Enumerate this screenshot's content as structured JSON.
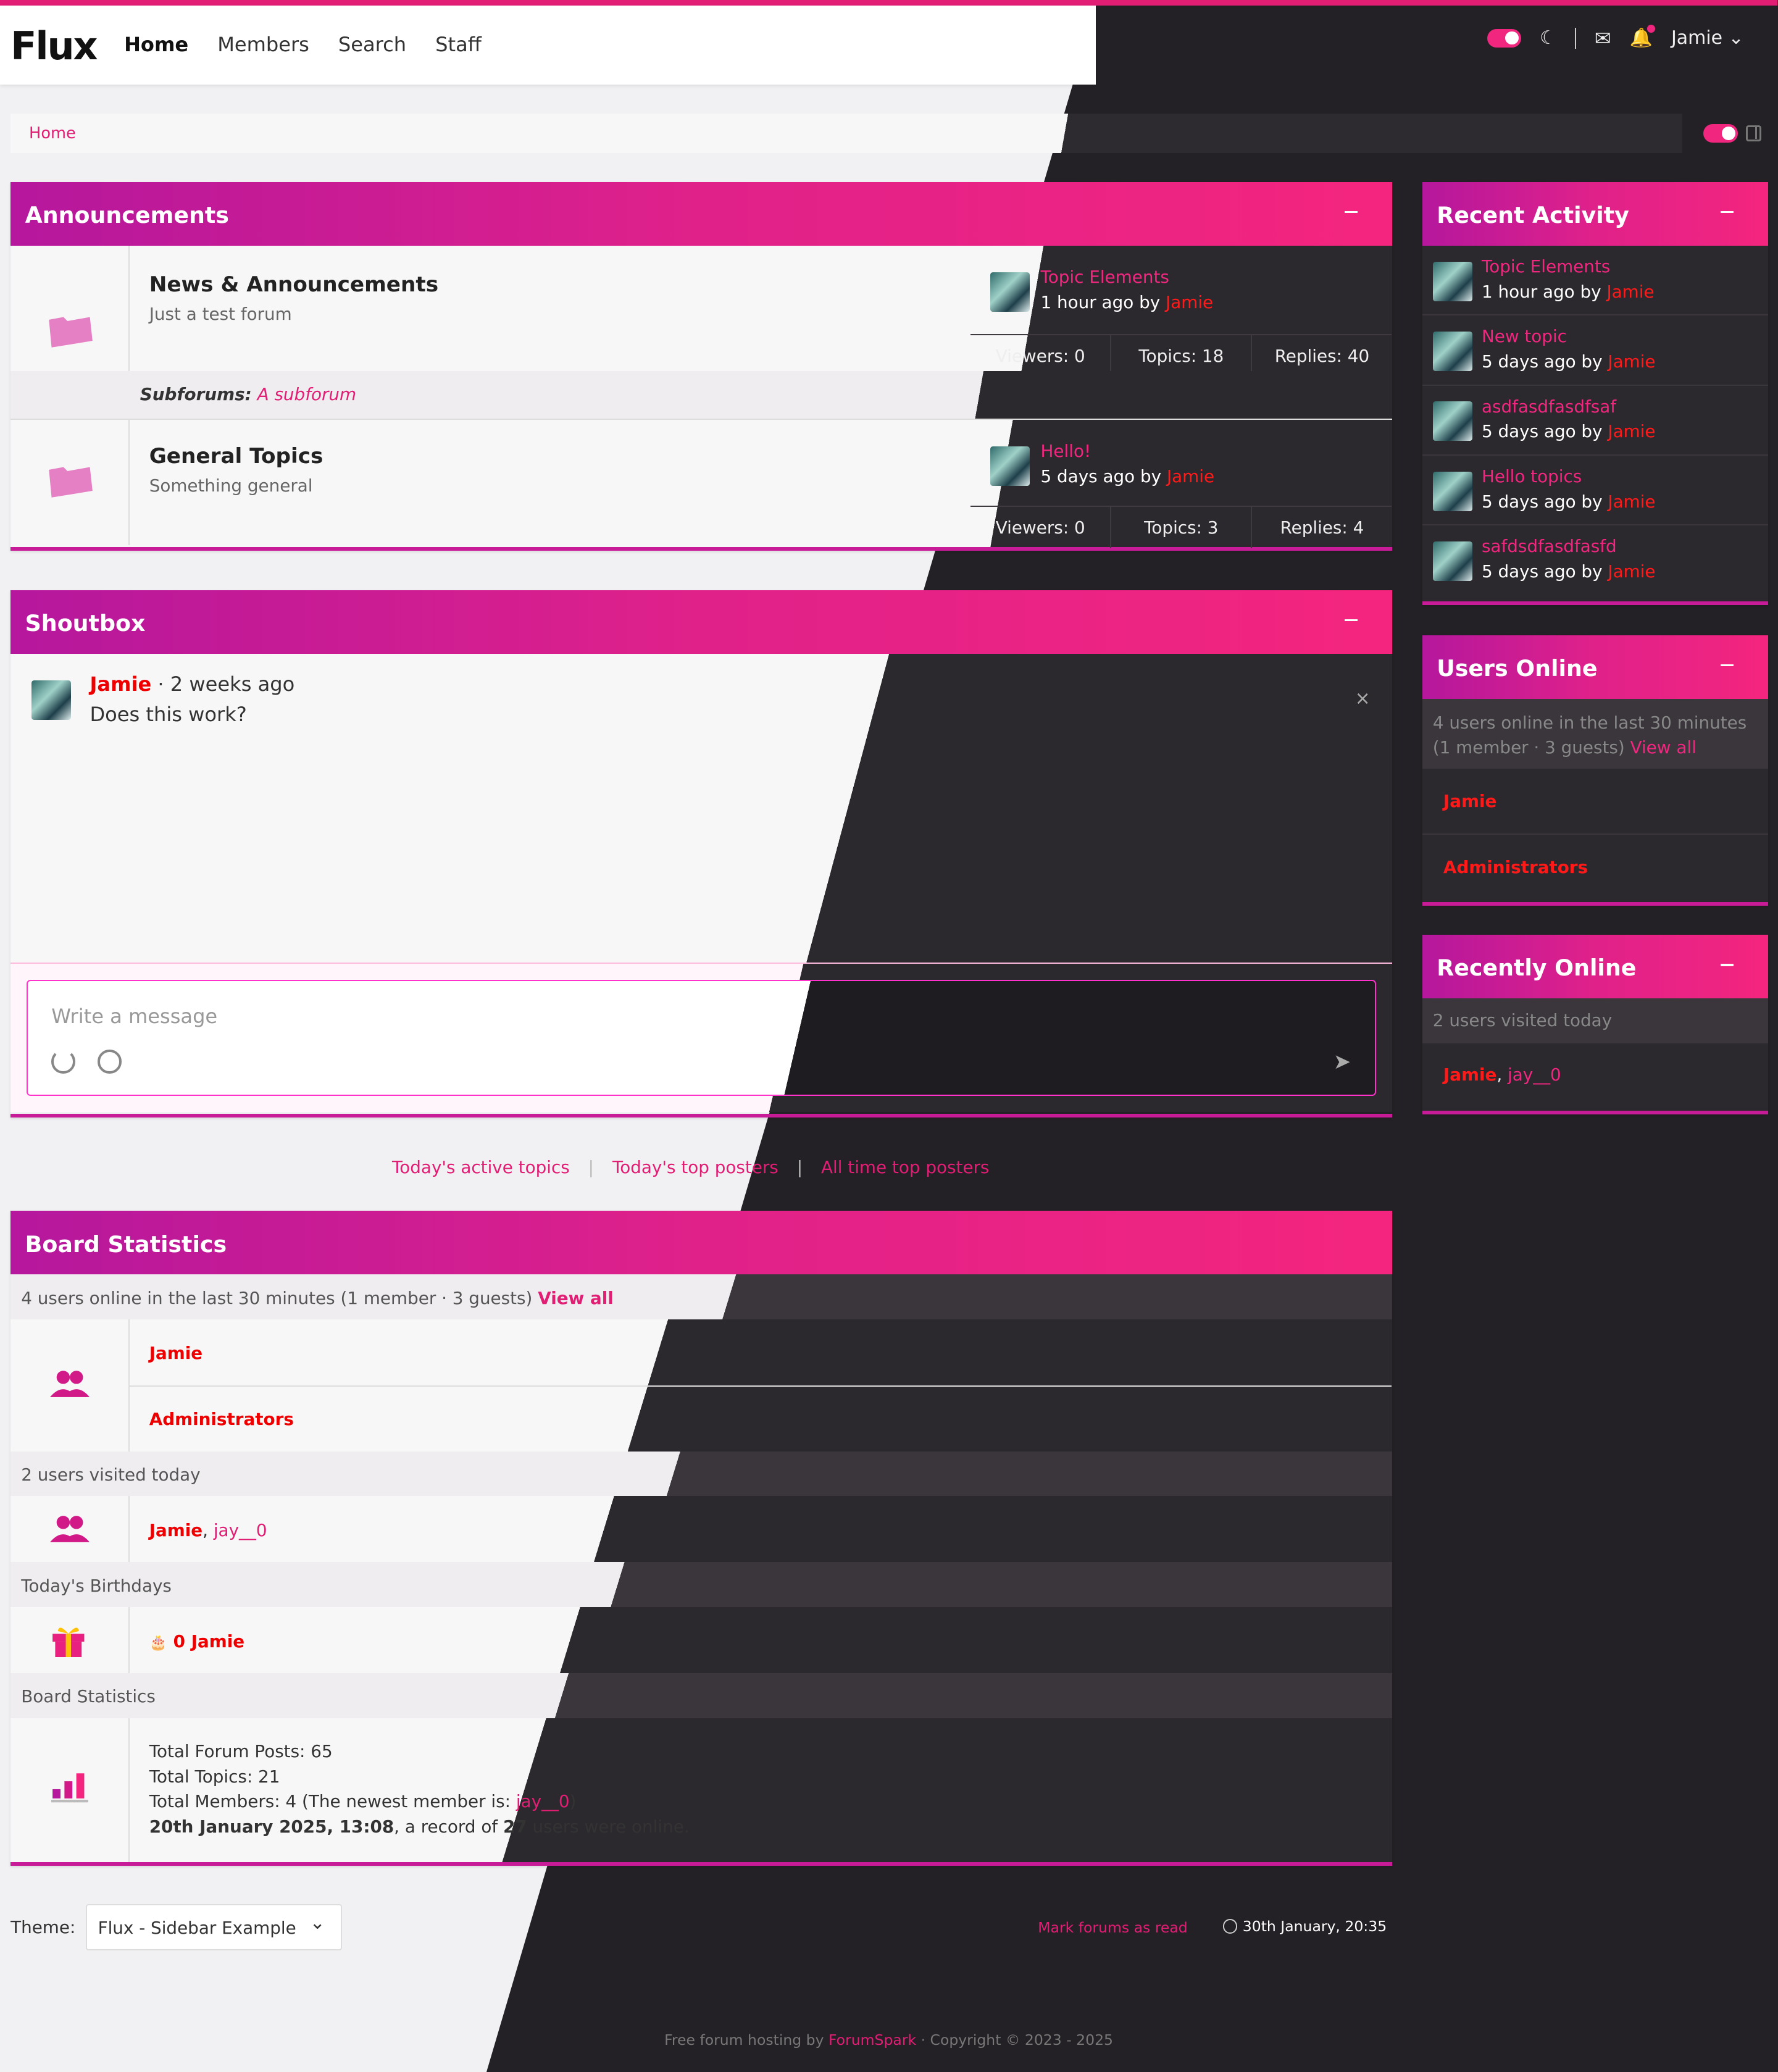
{
  "nav": {
    "logo": "Flux",
    "links": [
      "Home",
      "Members",
      "Search",
      "Staff"
    ],
    "user": "Jamie"
  },
  "breadcrumb": "Home",
  "colors": {
    "accent": "#e11d74",
    "gradient_start": "#b5179d",
    "gradient_end": "#f4257e",
    "dark_bg": "#242126"
  },
  "announcements": {
    "title": "Announcements",
    "forums": [
      {
        "name": "News & Announcements",
        "desc": "Just a test forum",
        "last_title": "Topic Elements",
        "last_time": "1 hour ago by",
        "last_user": "Jamie",
        "viewers": "Viewers: 0",
        "topics": "Topics: 18",
        "replies": "Replies: 40"
      },
      {
        "name": "General Topics",
        "desc": "Something general",
        "last_title": "Hello!",
        "last_time": "5 days ago by",
        "last_user": "Jamie",
        "viewers": "Viewers: 0",
        "topics": "Topics: 3",
        "replies": "Replies: 4"
      }
    ],
    "subforums_label": "Subforums:",
    "subforum": "A subforum"
  },
  "shoutbox": {
    "title": "Shoutbox",
    "user": "Jamie",
    "time": "· 2 weeks ago",
    "message": "Does this work?",
    "placeholder": "Write a message"
  },
  "links": [
    "Today's active topics",
    "Today's top posters",
    "All time top posters"
  ],
  "board": {
    "title": "Board Statistics",
    "online_text": "4 users online in the last 30 minutes (1 member · 3 guests)",
    "view_all": "View all",
    "online_users": "Jamie",
    "online_group": "Administrators",
    "visited_text": "2 users visited today",
    "visited_user1": "Jamie",
    "visited_sep": ", ",
    "visited_user2": "jay__0",
    "birthdays_text": "Today's Birthdays",
    "birthday_value": "0 Jamie",
    "stats_label": "Board Statistics",
    "total_posts": "Total Forum Posts: 65",
    "total_topics": "Total Topics: 21",
    "total_members": "Total Members: 4 (The newest member is: ",
    "newest": "jay__0",
    "total_members_end": ")",
    "record_date": "20th January 2025, 13:08",
    "record_mid": ", a record of ",
    "record_num": "27",
    "record_end": " users were online."
  },
  "recent_activity": {
    "title": "Recent Activity",
    "items": [
      {
        "title": "Topic Elements",
        "time": "1 hour ago by",
        "user": "Jamie"
      },
      {
        "title": "New topic",
        "time": "5 days ago by",
        "user": "Jamie"
      },
      {
        "title": "asdfasdfasdfsaf",
        "time": "5 days ago by",
        "user": "Jamie"
      },
      {
        "title": "Hello topics",
        "time": "5 days ago by",
        "user": "Jamie"
      },
      {
        "title": "safdsdfasdfasfd",
        "time": "5 days ago by",
        "user": "Jamie"
      }
    ]
  },
  "users_online": {
    "title": "Users Online",
    "text": "4 users online in the last 30 minutes (1 member · 3 guests)",
    "view_all": "View all",
    "user": "Jamie",
    "group": "Administrators"
  },
  "recently_online": {
    "title": "Recently Online",
    "text": "2 users visited today",
    "user1": "Jamie",
    "sep": ", ",
    "user2": "jay__0"
  },
  "footer": {
    "theme_label": "Theme:",
    "theme_value": "Flux - Sidebar Example",
    "mark_read": "Mark forums as read",
    "datetime": "30th January, 20:35",
    "copyright_pre": "Free forum hosting by ",
    "copyright_link": "ForumSpark",
    "copyright_post": " · Copyright © 2023 - 2025"
  }
}
